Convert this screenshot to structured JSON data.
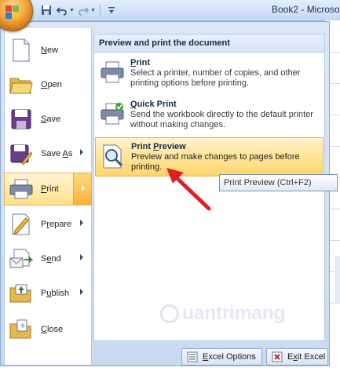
{
  "window": {
    "title": "Book2 - Microso"
  },
  "quick_access": {
    "items": [
      "save-icon",
      "undo-icon",
      "redo-icon",
      "customize-icon"
    ]
  },
  "office_menu": {
    "left_items": [
      {
        "label": "New",
        "underline_index": 0,
        "icon": "new-document-icon",
        "has_arrow": false
      },
      {
        "label": "Open",
        "underline_index": 0,
        "icon": "open-folder-icon",
        "has_arrow": false
      },
      {
        "label": "Save",
        "underline_index": 0,
        "icon": "save-disk-icon",
        "has_arrow": false
      },
      {
        "label": "Save As",
        "underline_index": 5,
        "icon": "save-as-icon",
        "has_arrow": true
      },
      {
        "label": "Print",
        "underline_index": 0,
        "icon": "printer-icon",
        "has_arrow": true,
        "active": true
      },
      {
        "label": "Prepare",
        "underline_index": 1,
        "icon": "prepare-icon",
        "has_arrow": true
      },
      {
        "label": "Send",
        "underline_index": 1,
        "icon": "send-icon",
        "has_arrow": true
      },
      {
        "label": "Publish",
        "underline_index": 1,
        "icon": "publish-icon",
        "has_arrow": true
      },
      {
        "label": "Close",
        "underline_index": 0,
        "icon": "close-document-icon",
        "has_arrow": false
      }
    ],
    "print_submenu": {
      "header": "Preview and print the document",
      "items": [
        {
          "title": "Print",
          "underline_index": 0,
          "description": "Select a printer, number of copies, and other printing options before printing.",
          "icon": "printer-icon"
        },
        {
          "title": "Quick Print",
          "underline_index": 0,
          "description": "Send the workbook directly to the default printer without making changes.",
          "icon": "quick-print-icon"
        },
        {
          "title": "Print Preview",
          "underline_index": 6,
          "description": "Preview and make changes to pages before printing.",
          "icon": "print-preview-icon",
          "highlighted": true
        }
      ]
    },
    "tooltip": "Print Preview (Ctrl+F2)",
    "bottom_buttons": [
      {
        "label": "Excel Options",
        "underline_index": 0,
        "icon": "options-icon"
      },
      {
        "label": "Exit Excel",
        "underline_index": 1,
        "icon": "exit-icon"
      }
    ]
  },
  "watermark": {
    "text": "uantrimang"
  },
  "colors": {
    "annotation_arrow": "#e02020",
    "highlight": "#ffd46c"
  }
}
